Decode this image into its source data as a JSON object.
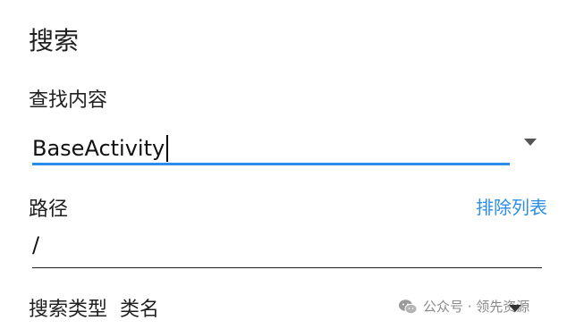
{
  "dialog": {
    "title": "搜索",
    "find": {
      "label": "查找内容",
      "value": "BaseActivity",
      "dropdown_icon": "chevron-down-icon"
    },
    "path": {
      "label": "路径",
      "exclude_link": "排除列表",
      "value": "/"
    },
    "search_type": {
      "label": "搜索类型",
      "value": "类名",
      "dropdown_icon": "chevron-down-icon"
    }
  },
  "watermark": {
    "icon": "wechat-icon",
    "text": "公众号 · 领先资源"
  },
  "colors": {
    "accent": "#2b8eea",
    "text": "#202020",
    "muted": "#8a8a8a"
  }
}
